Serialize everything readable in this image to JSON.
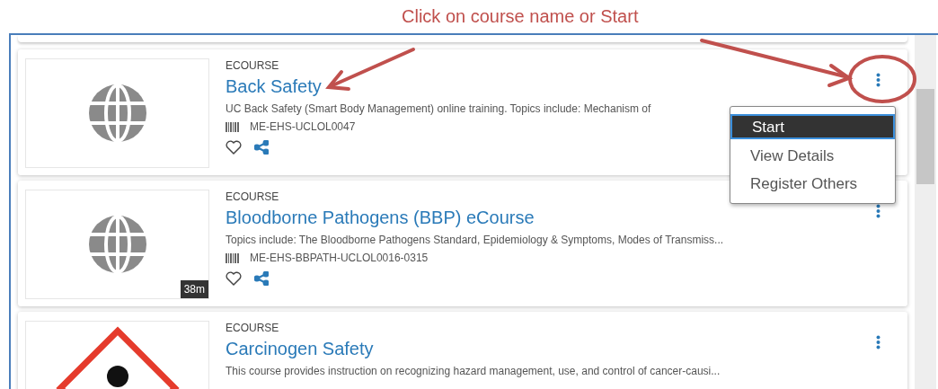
{
  "annotation": {
    "text": "Click on course name or Start"
  },
  "courses": [
    {
      "type": "ECOURSE",
      "title": "Back Safety",
      "description": "UC Back Safety (Smart Body Management) online training. Topics include: Mechanism of",
      "code": "ME-EHS-UCLOL0047",
      "kind": "globe"
    },
    {
      "type": "ECOURSE",
      "title": "Bloodborne Pathogens (BBP) eCourse",
      "description": "Topics include: The Bloodborne Pathogens Standard, Epidemiology & Symptoms, Modes of Transmiss...",
      "code": "ME-EHS-BBPATH-UCLOL0016-0315",
      "kind": "globe",
      "duration": "38m"
    },
    {
      "type": "ECOURSE",
      "title": "Carcinogen Safety",
      "description": "This course provides instruction on recognizing hazard management, use, and control of cancer-causi...",
      "kind": "hazard"
    }
  ],
  "menu": {
    "items": [
      {
        "label": "Start",
        "selected": true
      },
      {
        "label": "View Details",
        "selected": false
      },
      {
        "label": "Register Others",
        "selected": false
      }
    ]
  }
}
